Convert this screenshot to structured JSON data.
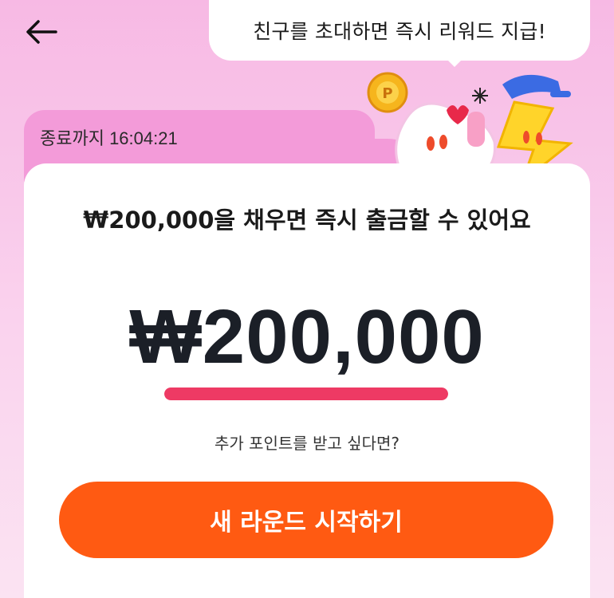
{
  "header": {
    "back_icon": "arrow-left-icon",
    "bubble_text": "친구를 초대하면 즉시 리워드 지급!"
  },
  "timer": {
    "text": "종료까지 16:04:21"
  },
  "card": {
    "title": "₩200,000을 채우면 즉시 출금할 수 있어요",
    "amount": "₩200,000",
    "progress_fraction": 1.0,
    "subtitle": "추가 포인트를 받고 싶다면?",
    "cta_label": "새 라운드 시작하기"
  },
  "colors": {
    "background": "#f7b9e4",
    "timer_tab": "#f39bd9",
    "progress_fill": "#ee3a64",
    "cta": "#ff5a12"
  }
}
